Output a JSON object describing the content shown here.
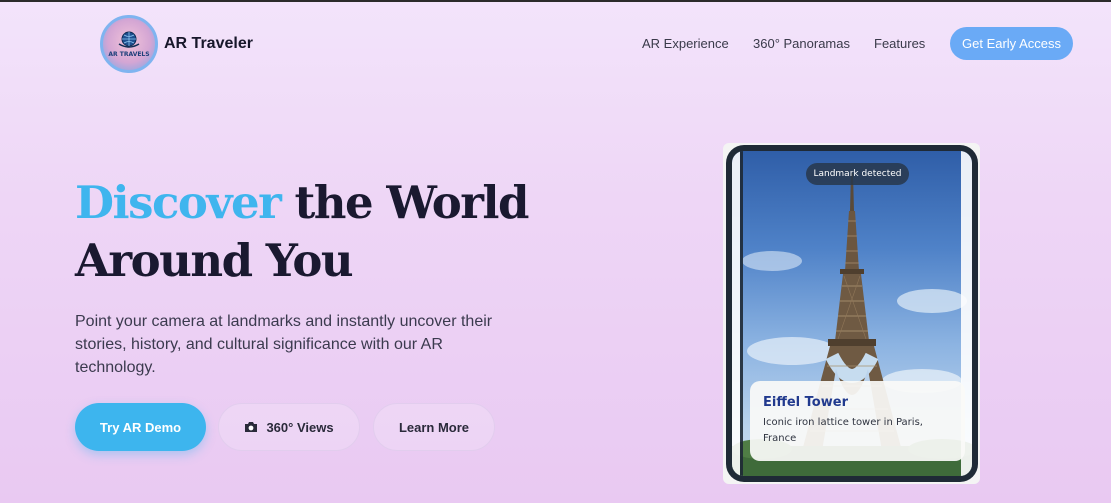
{
  "header": {
    "brand": "AR Traveler",
    "logo_text": "AR TRAVELS",
    "nav": [
      "AR Experience",
      "360° Panoramas",
      "Features"
    ],
    "cta": "Get Early Access"
  },
  "hero": {
    "title_accent": "Discover",
    "title_rest": " the World Around You",
    "description": "Point your camera at landmarks and instantly uncover their stories, history, and cultural significance with our AR technology.",
    "buttons": {
      "primary": "Try AR Demo",
      "secondary": "360° Views",
      "tertiary": "Learn More"
    }
  },
  "phone": {
    "badge": "Landmark detected",
    "card_title": "Eiffel Tower",
    "card_desc": "Iconic iron lattice tower in Paris, France"
  },
  "colors": {
    "accent": "#3fb5ee",
    "cta": "#6aaaf6",
    "card_title": "#213a8e"
  },
  "icons": [
    "globe-logo-icon",
    "camera-icon"
  ]
}
